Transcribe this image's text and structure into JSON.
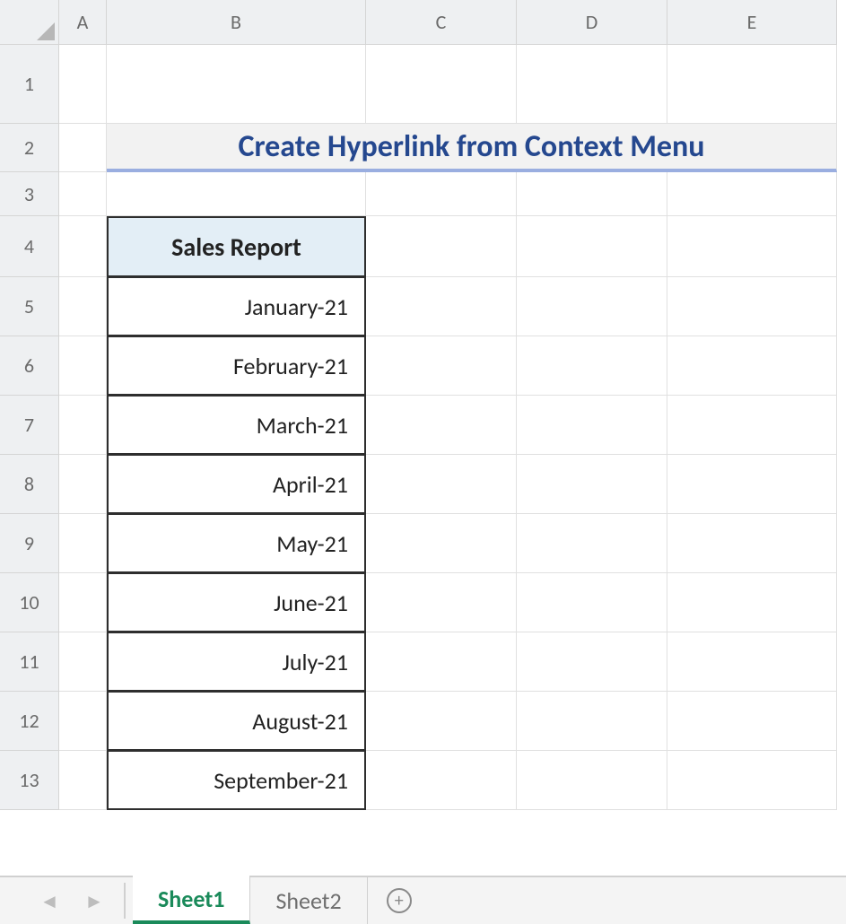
{
  "columns": [
    "A",
    "B",
    "C",
    "D",
    "E"
  ],
  "rows": [
    "1",
    "2",
    "3",
    "4",
    "5",
    "6",
    "7",
    "8",
    "9",
    "10",
    "11",
    "12",
    "13"
  ],
  "title": "Create Hyperlink from Context Menu",
  "table": {
    "header": "Sales Report",
    "data": [
      "January-21",
      "February-21",
      "March-21",
      "April-21",
      "May-21",
      "June-21",
      "July-21",
      "August-21",
      "September-21"
    ]
  },
  "tabs": {
    "active": "Sheet1",
    "inactive": "Sheet2"
  },
  "nav": {
    "prev": "◄",
    "next": "►"
  },
  "add_icon": "+"
}
